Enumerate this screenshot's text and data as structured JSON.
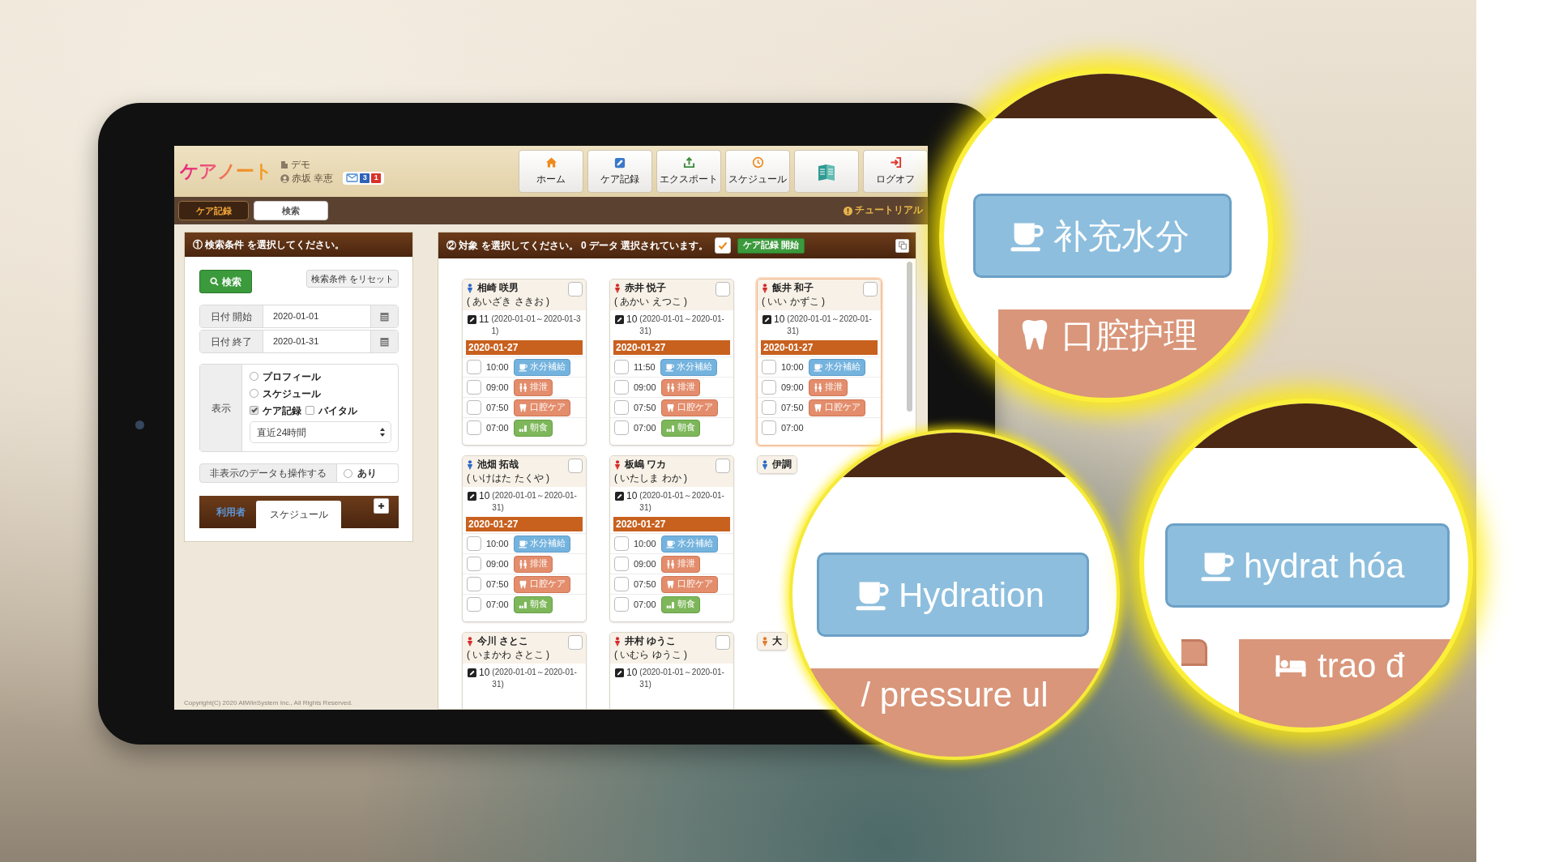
{
  "app": {
    "logo": "ケアノート",
    "organization": "デモ",
    "user": "赤坂 幸恵",
    "message_counts": [
      {
        "text": "3",
        "color": "#2d62b8"
      },
      {
        "text": "1",
        "color": "#d8322a"
      }
    ],
    "nav": [
      {
        "kind": "home",
        "label": "ホーム"
      },
      {
        "kind": "record",
        "label": "ケア記録"
      },
      {
        "kind": "export",
        "label": "エクスポート"
      },
      {
        "kind": "schedule",
        "label": "スケジュール"
      },
      {
        "kind": "manual"
      },
      {
        "kind": "logout",
        "label": "ログオフ"
      }
    ],
    "tabs": [
      {
        "label": "ケア記録",
        "selected": true
      },
      {
        "label": "検索",
        "selected": false
      }
    ],
    "tutorial": "チュートリアル",
    "search_panel": {
      "title": "① 検索条件 を選択してください。",
      "search_button": "検索",
      "reset_button": "検索条件 をリセット",
      "date_fields": [
        {
          "label": "日付 開始",
          "value": "2020-01-01"
        },
        {
          "label": "日付 終了",
          "value": "2020-01-31"
        }
      ],
      "display_label": "表示",
      "display_options": [
        {
          "kind": "radio",
          "label": "プロフィール",
          "checked": false
        },
        {
          "kind": "radio",
          "label": "スケジュール",
          "checked": false
        },
        {
          "kind": "checkbox",
          "label": "ケア記録",
          "checked": true
        },
        {
          "kind": "checkbox",
          "label": "バイタル",
          "checked": false
        }
      ],
      "period": "直近24時間",
      "hidden_data_label": "非表示のデータも操作する",
      "hidden_data_option": {
        "label": "あり",
        "checked": false
      },
      "tabs": [
        {
          "label": "利用者",
          "selected": false
        },
        {
          "label": "スケジュール",
          "selected": true
        }
      ]
    },
    "target_panel": {
      "title": "② 対象 を選択してください。 0 データ 選択されています。",
      "start_button": "ケア記録 開始",
      "cards": [
        {
          "name": "相崎 咲男",
          "reading": "( あいざき さきお )",
          "color": "#2b67c6",
          "checked": false,
          "highlighted": false,
          "count": "11",
          "range": "(2020-01-01～2020-01-31)",
          "date": "2020-01-27",
          "entries": [
            {
              "checked": false,
              "time": "10:00",
              "kind": "hydration",
              "label": "水分補給"
            },
            {
              "checked": false,
              "time": "09:00",
              "kind": "excretion",
              "label": "排泄"
            },
            {
              "checked": false,
              "time": "07:50",
              "kind": "oral",
              "label": "口腔ケア"
            },
            {
              "checked": false,
              "time": "07:00",
              "kind": "meal",
              "label": "朝食"
            }
          ]
        },
        {
          "name": "赤井 悦子",
          "reading": "( あかい えつこ )",
          "color": "#d42a2a",
          "checked": false,
          "highlighted": false,
          "count": "10",
          "range": "(2020-01-01～2020-01-31)",
          "date": "2020-01-27",
          "entries": [
            {
              "checked": false,
              "time": "11:50",
              "kind": "hydration",
              "label": "水分補給"
            },
            {
              "checked": false,
              "time": "09:00",
              "kind": "excretion",
              "label": "排泄"
            },
            {
              "checked": false,
              "time": "07:50",
              "kind": "oral",
              "label": "口腔ケア"
            },
            {
              "checked": false,
              "time": "07:00",
              "kind": "meal",
              "label": "朝食"
            }
          ]
        },
        {
          "name": "飯井 和子",
          "reading": "( いい かずこ )",
          "color": "#d42a2a",
          "checked": false,
          "highlighted": true,
          "count": "10",
          "range": "(2020-01-01～2020-01-31)",
          "date": "2020-01-27",
          "entries": [
            {
              "checked": false,
              "time": "10:00",
              "kind": "hydration",
              "label": "水分補給"
            },
            {
              "checked": false,
              "time": "09:00",
              "kind": "excretion",
              "label": "排泄"
            },
            {
              "checked": false,
              "time": "07:50",
              "kind": "oral",
              "label": "口腔ケア"
            },
            {
              "checked": false,
              "time": "07:00"
            }
          ]
        },
        {
          "name": "池畑 拓哉",
          "reading": "( いけはた たくや )",
          "color": "#2b67c6",
          "checked": false,
          "highlighted": false,
          "count": "10",
          "range": "(2020-01-01～2020-01-31)",
          "date": "2020-01-27",
          "entries": [
            {
              "checked": false,
              "time": "10:00",
              "kind": "hydration",
              "label": "水分補給"
            },
            {
              "checked": false,
              "time": "09:00",
              "kind": "excretion",
              "label": "排泄"
            },
            {
              "checked": false,
              "time": "07:50",
              "kind": "oral",
              "label": "口腔ケア"
            },
            {
              "checked": false,
              "time": "07:00",
              "kind": "meal",
              "label": "朝食"
            }
          ]
        },
        {
          "name": "板嶋 ワカ",
          "reading": "( いたしま わか )",
          "color": "#d42a2a",
          "checked": false,
          "highlighted": false,
          "count": "10",
          "range": "(2020-01-01～2020-01-31)",
          "date": "2020-01-27",
          "entries": [
            {
              "checked": false,
              "time": "10:00",
              "kind": "hydration",
              "label": "水分補給"
            },
            {
              "checked": false,
              "time": "09:00",
              "kind": "excretion",
              "label": "排泄"
            },
            {
              "checked": false,
              "time": "07:50",
              "kind": "oral",
              "label": "口腔ケア"
            },
            {
              "checked": false,
              "time": "07:00",
              "kind": "meal",
              "label": "朝食"
            }
          ]
        },
        {
          "name": "伊調",
          "color": "#2b67c6",
          "highlighted": false
        },
        {
          "name": "今川 さとこ",
          "reading": "( いまかわ さとこ )",
          "color": "#d42a2a",
          "checked": false,
          "highlighted": false,
          "count": "10",
          "range": "(2020-01-01～2020-01-31)"
        },
        {
          "name": "井村 ゆうこ",
          "reading": "( いむら ゆうこ )",
          "color": "#d42a2a",
          "checked": false,
          "highlighted": false,
          "count": "10",
          "range": "(2020-01-01～2020-01-31)"
        },
        {
          "name": "大",
          "color": "#e07a2a",
          "highlighted": false
        }
      ]
    },
    "copyright": "Copyright(C) 2020 AllWinSystem Inc., All Rights Reserved."
  },
  "magnifiers": [
    {
      "buttons": [
        {
          "kind": "hydration",
          "label": "补充水分"
        },
        {
          "kind": "oral",
          "label": "口腔护理"
        }
      ]
    },
    {
      "buttons": [
        {
          "kind": "hydration",
          "label": "Hydration"
        },
        {
          "kind": "care",
          "label": "/ pressure ul"
        }
      ]
    },
    {
      "buttons": [
        {
          "kind": "hydration",
          "label": "hydrat hóa"
        },
        {
          "kind": "care"
        },
        {
          "kind": "position",
          "label": "trao đ"
        }
      ]
    }
  ]
}
